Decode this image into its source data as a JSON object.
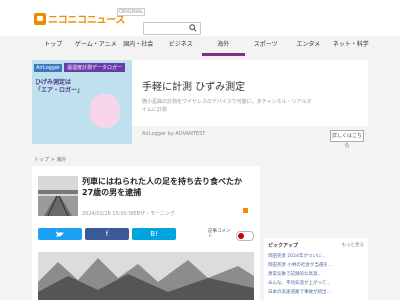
{
  "header": {
    "logo_text": "ニコニコニュース",
    "logo_tag": "ORIGINAL",
    "search": {
      "placeholder": ""
    }
  },
  "nav": {
    "items": [
      {
        "label": "トップ"
      },
      {
        "label": "ゲーム・アニメ"
      },
      {
        "label": "国内・社会"
      },
      {
        "label": "ビジネス"
      },
      {
        "label": "海外"
      },
      {
        "label": "スポーツ"
      },
      {
        "label": "エンタメ"
      },
      {
        "label": "ネット・科学"
      }
    ],
    "active_index": 4,
    "active_color": "#8a2b8a"
  },
  "ad": {
    "brand": "AirLogger",
    "banner": "温湿度計測データロガー",
    "image_text": "ひげみ測定は\n「エア・ロガー」",
    "title": "手軽に計測 ひずみ測定",
    "description": "微小歪曲の計測をワイヤレスのデバイスで可能に。多チャンネル・リアルタイムに計測",
    "sponsor": "AirLogger by ADVANTEST",
    "learn_more": "詳しくはこちら"
  },
  "breadcrumb": {
    "home": "トップ",
    "sep": ">",
    "current": "海外"
  },
  "article": {
    "headline": "列車にはねられた人の足を持ち去り食べたか　27歳の男を逮捕",
    "date": "2024/02/26 15:00",
    "source": "WEBザ・モーニング",
    "share": {
      "twitter": "",
      "facebook": "f",
      "hatena": "B!"
    },
    "toggle_label": "記事コメント",
    "toggle_on": true
  },
  "sidebar": {
    "heading": "ピックアップ",
    "more": "もっと見る",
    "items": [
      {
        "label": "岡田英彦 2024年がついに..."
      },
      {
        "label": "岡田英彦 小林の社会が当選を..."
      },
      {
        "label": "異常気象で記録的な高温..."
      },
      {
        "label": "みんな、平均気温が上がって..."
      },
      {
        "label": "日本の高速道路で事故が続出..."
      }
    ]
  }
}
